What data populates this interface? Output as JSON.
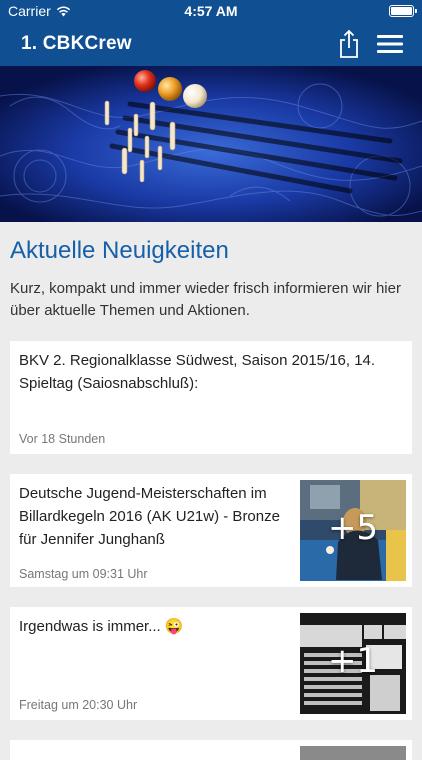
{
  "status_bar": {
    "carrier": "Carrier",
    "time": "4:57 AM"
  },
  "nav": {
    "title": "1. CBKCrew",
    "share_icon": "share-icon",
    "menu_icon": "hamburger-menu-icon"
  },
  "section": {
    "title": "Aktuelle Neuigkeiten",
    "intro": "Kurz, kompakt und immer wieder frisch informieren wir hier über aktuelle Themen und Aktionen."
  },
  "news": [
    {
      "text": "BKV 2. Regionalklasse Südwest, Saison 2015/16, 14. Spieltag (Saiosnabschluß):",
      "meta": "Vor 18 Stunden"
    },
    {
      "text": "Deutsche Jugend-Meisterschaften im Billardkegeln 2016 (AK U21w) - Bronze für Jennifer Junghanß",
      "meta": "Samstag um 09:31 Uhr",
      "image_count": "+5"
    },
    {
      "text": "Irgendwas is immer... 😜",
      "meta": "Freitag um 20:30 Uhr",
      "image_count": "+1"
    }
  ],
  "colors": {
    "brand": "#0f4f92",
    "heading": "#1560a8",
    "background": "#ececec"
  }
}
